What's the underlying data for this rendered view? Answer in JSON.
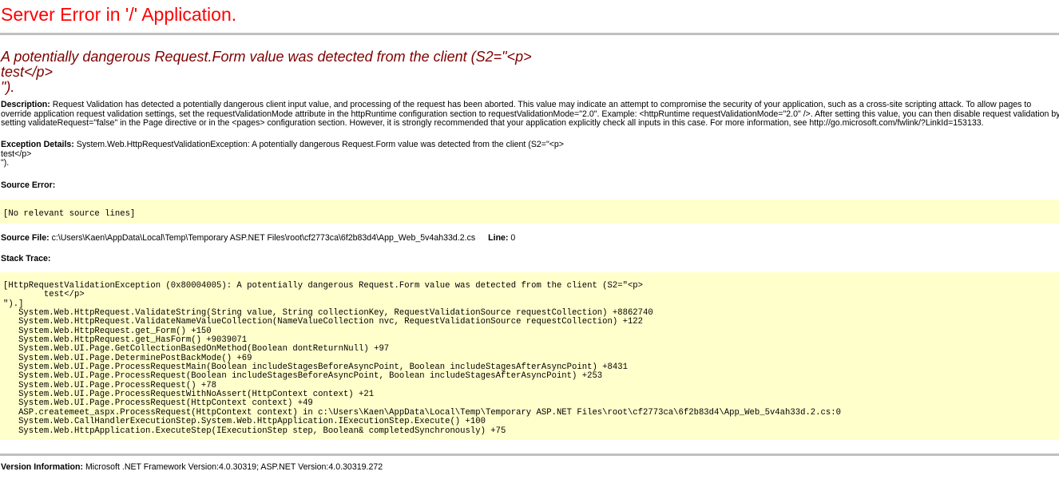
{
  "page": {
    "title": "Server Error in '/' Application."
  },
  "error": {
    "heading_lines": [
      "A potentially dangerous Request.Form value was detected from the client (S2=\"<p>",
      "test</p>",
      "\")."
    ]
  },
  "description": {
    "label": "Description:",
    "lines": [
      " Request Validation has detected a potentially dangerous client input value, and processing of the request has been aborted. This value may indicate an attempt to compromise the security of your application, such as a cross-site scripting attack. To allow pages to",
      "override application request validation settings, set the requestValidationMode attribute in the httpRuntime configuration section to requestValidationMode=\"2.0\". Example: <httpRuntime requestValidationMode=\"2.0\" />. After setting this value, you can then disable request validation by",
      "setting validateRequest=\"false\" in the Page directive or in the <pages> configuration section. However, it is strongly recommended that your application explicitly check all inputs in this case. For more information, see http://go.microsoft.com/fwlink/?LinkId=153133."
    ]
  },
  "exception": {
    "label": "Exception Details:",
    "lines": [
      " System.Web.HttpRequestValidationException: A potentially dangerous Request.Form value was detected from the client (S2=\"<p>",
      "test</p>",
      "\")."
    ]
  },
  "source_error": {
    "label": "Source Error:",
    "code": "[No relevant source lines]"
  },
  "source_file": {
    "label": "Source File:",
    "path": " c:\\Users\\Kaen\\AppData\\Local\\Temp\\Temporary ASP.NET Files\\root\\cf2773ca\\6f2b83d4\\App_Web_5v4ah33d.2.cs",
    "line_label": "Line:",
    "line_value": " 0"
  },
  "stack_trace": {
    "label": "Stack Trace:",
    "lines": [
      "[HttpRequestValidationException (0x80004005): A potentially dangerous Request.Form value was detected from the client (S2=\"<p>",
      "        test</p>",
      "\").]",
      "   System.Web.HttpRequest.ValidateString(String value, String collectionKey, RequestValidationSource requestCollection) +8862740",
      "   System.Web.HttpRequest.ValidateNameValueCollection(NameValueCollection nvc, RequestValidationSource requestCollection) +122",
      "   System.Web.HttpRequest.get_Form() +150",
      "   System.Web.HttpRequest.get_HasForm() +9039071",
      "   System.Web.UI.Page.GetCollectionBasedOnMethod(Boolean dontReturnNull) +97",
      "   System.Web.UI.Page.DeterminePostBackMode() +69",
      "   System.Web.UI.Page.ProcessRequestMain(Boolean includeStagesBeforeAsyncPoint, Boolean includeStagesAfterAsyncPoint) +8431",
      "   System.Web.UI.Page.ProcessRequest(Boolean includeStagesBeforeAsyncPoint, Boolean includeStagesAfterAsyncPoint) +253",
      "   System.Web.UI.Page.ProcessRequest() +78",
      "   System.Web.UI.Page.ProcessRequestWithNoAssert(HttpContext context) +21",
      "   System.Web.UI.Page.ProcessRequest(HttpContext context) +49",
      "   ASP.createmeet_aspx.ProcessRequest(HttpContext context) in c:\\Users\\Kaen\\AppData\\Local\\Temp\\Temporary ASP.NET Files\\root\\cf2773ca\\6f2b83d4\\App_Web_5v4ah33d.2.cs:0",
      "   System.Web.CallHandlerExecutionStep.System.Web.HttpApplication.IExecutionStep.Execute() +100",
      "   System.Web.HttpApplication.ExecuteStep(IExecutionStep step, Boolean& completedSynchronously) +75"
    ]
  },
  "version": {
    "label": "Version Information:",
    "text": " Microsoft .NET Framework Version:4.0.30319; ASP.NET Version:4.0.30319.272"
  },
  "colors": {
    "title": "#ff0000",
    "heading": "#800000",
    "code_background": "#ffffcc",
    "rule": "#c0c0c0"
  }
}
